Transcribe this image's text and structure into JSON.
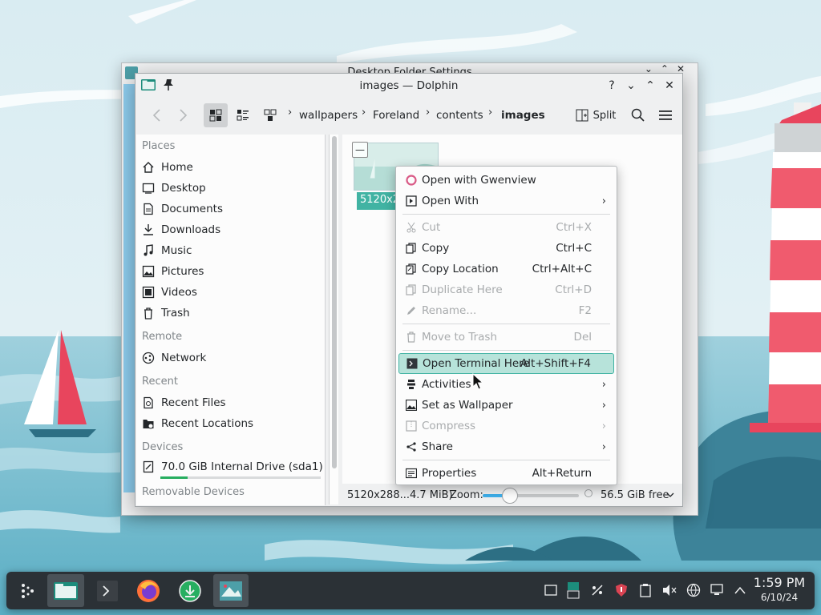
{
  "background_window": {
    "title": "Desktop Folder Settings"
  },
  "window": {
    "title": "images — Dolphin",
    "controls": {
      "help": "?",
      "minimize": "⌄",
      "maximize": "⌃",
      "close": "✕"
    }
  },
  "toolbar": {
    "breadcrumb": [
      "wallpapers",
      "Foreland",
      "contents",
      "images"
    ],
    "split_label": "Split"
  },
  "sidebar": {
    "sections": {
      "places": "Places",
      "remote": "Remote",
      "recent": "Recent",
      "devices": "Devices",
      "removable": "Removable Devices"
    },
    "places": [
      {
        "label": "Home",
        "icon": "home-icon"
      },
      {
        "label": "Desktop",
        "icon": "desktop-icon"
      },
      {
        "label": "Documents",
        "icon": "documents-icon"
      },
      {
        "label": "Downloads",
        "icon": "downloads-icon"
      },
      {
        "label": "Music",
        "icon": "music-icon"
      },
      {
        "label": "Pictures",
        "icon": "pictures-icon"
      },
      {
        "label": "Videos",
        "icon": "videos-icon"
      },
      {
        "label": "Trash",
        "icon": "trash-icon"
      }
    ],
    "remote": [
      {
        "label": "Network",
        "icon": "network-icon"
      }
    ],
    "recent": [
      {
        "label": "Recent Files",
        "icon": "recent-files-icon"
      },
      {
        "label": "Recent Locations",
        "icon": "recent-locations-icon"
      }
    ],
    "devices": [
      {
        "label": "70.0 GiB Internal Drive (sda1)",
        "icon": "drive-icon",
        "usage_fraction": 0.17
      }
    ]
  },
  "content": {
    "file": {
      "label": "5120x2"
    }
  },
  "statusbar": {
    "info": "5120x288...4.7 MiB)",
    "zoom_label": "Zoom:",
    "zoom_fraction": 0.28,
    "free_space": "56.5 GiB free"
  },
  "context_menu": {
    "items": [
      {
        "label": "Open with Gwenview",
        "shortcut": "",
        "icon": "gwenview-icon",
        "disabled": false,
        "submenu": false
      },
      {
        "label": "Open With",
        "shortcut": "",
        "icon": "open-with-icon",
        "disabled": false,
        "submenu": true
      },
      {
        "label": "Cut",
        "shortcut": "Ctrl+X",
        "icon": "cut-icon",
        "disabled": true,
        "submenu": false
      },
      {
        "label": "Copy",
        "shortcut": "Ctrl+C",
        "icon": "copy-icon",
        "disabled": false,
        "submenu": false
      },
      {
        "label": "Copy Location",
        "shortcut": "Ctrl+Alt+C",
        "icon": "copy-location-icon",
        "disabled": false,
        "submenu": false
      },
      {
        "label": "Duplicate Here",
        "shortcut": "Ctrl+D",
        "icon": "duplicate-icon",
        "disabled": true,
        "submenu": false
      },
      {
        "label": "Rename...",
        "shortcut": "F2",
        "icon": "rename-icon",
        "disabled": true,
        "submenu": false
      },
      {
        "label": "Move to Trash",
        "shortcut": "Del",
        "icon": "trash-icon",
        "disabled": true,
        "submenu": false
      },
      {
        "label": "Open Terminal Here",
        "shortcut": "Alt+Shift+F4",
        "icon": "terminal-icon",
        "disabled": false,
        "submenu": false,
        "highlighted": true
      },
      {
        "label": "Activities",
        "shortcut": "",
        "icon": "activities-icon",
        "disabled": false,
        "submenu": true
      },
      {
        "label": "Set as Wallpaper",
        "shortcut": "",
        "icon": "wallpaper-icon",
        "disabled": false,
        "submenu": true
      },
      {
        "label": "Compress",
        "shortcut": "",
        "icon": "compress-icon",
        "disabled": true,
        "submenu": true
      },
      {
        "label": "Share",
        "shortcut": "",
        "icon": "share-icon",
        "disabled": false,
        "submenu": true
      },
      {
        "label": "Properties",
        "shortcut": "Alt+Return",
        "icon": "properties-icon",
        "disabled": false,
        "submenu": false
      }
    ]
  },
  "taskbar": {
    "clock": {
      "time": "1:59 PM",
      "date": "6/10/24"
    }
  },
  "colors": {
    "accent": "#3daee9",
    "highlight": "#b7e3da",
    "taskbar": "#2b3136",
    "sea": "#7fc3d6"
  }
}
